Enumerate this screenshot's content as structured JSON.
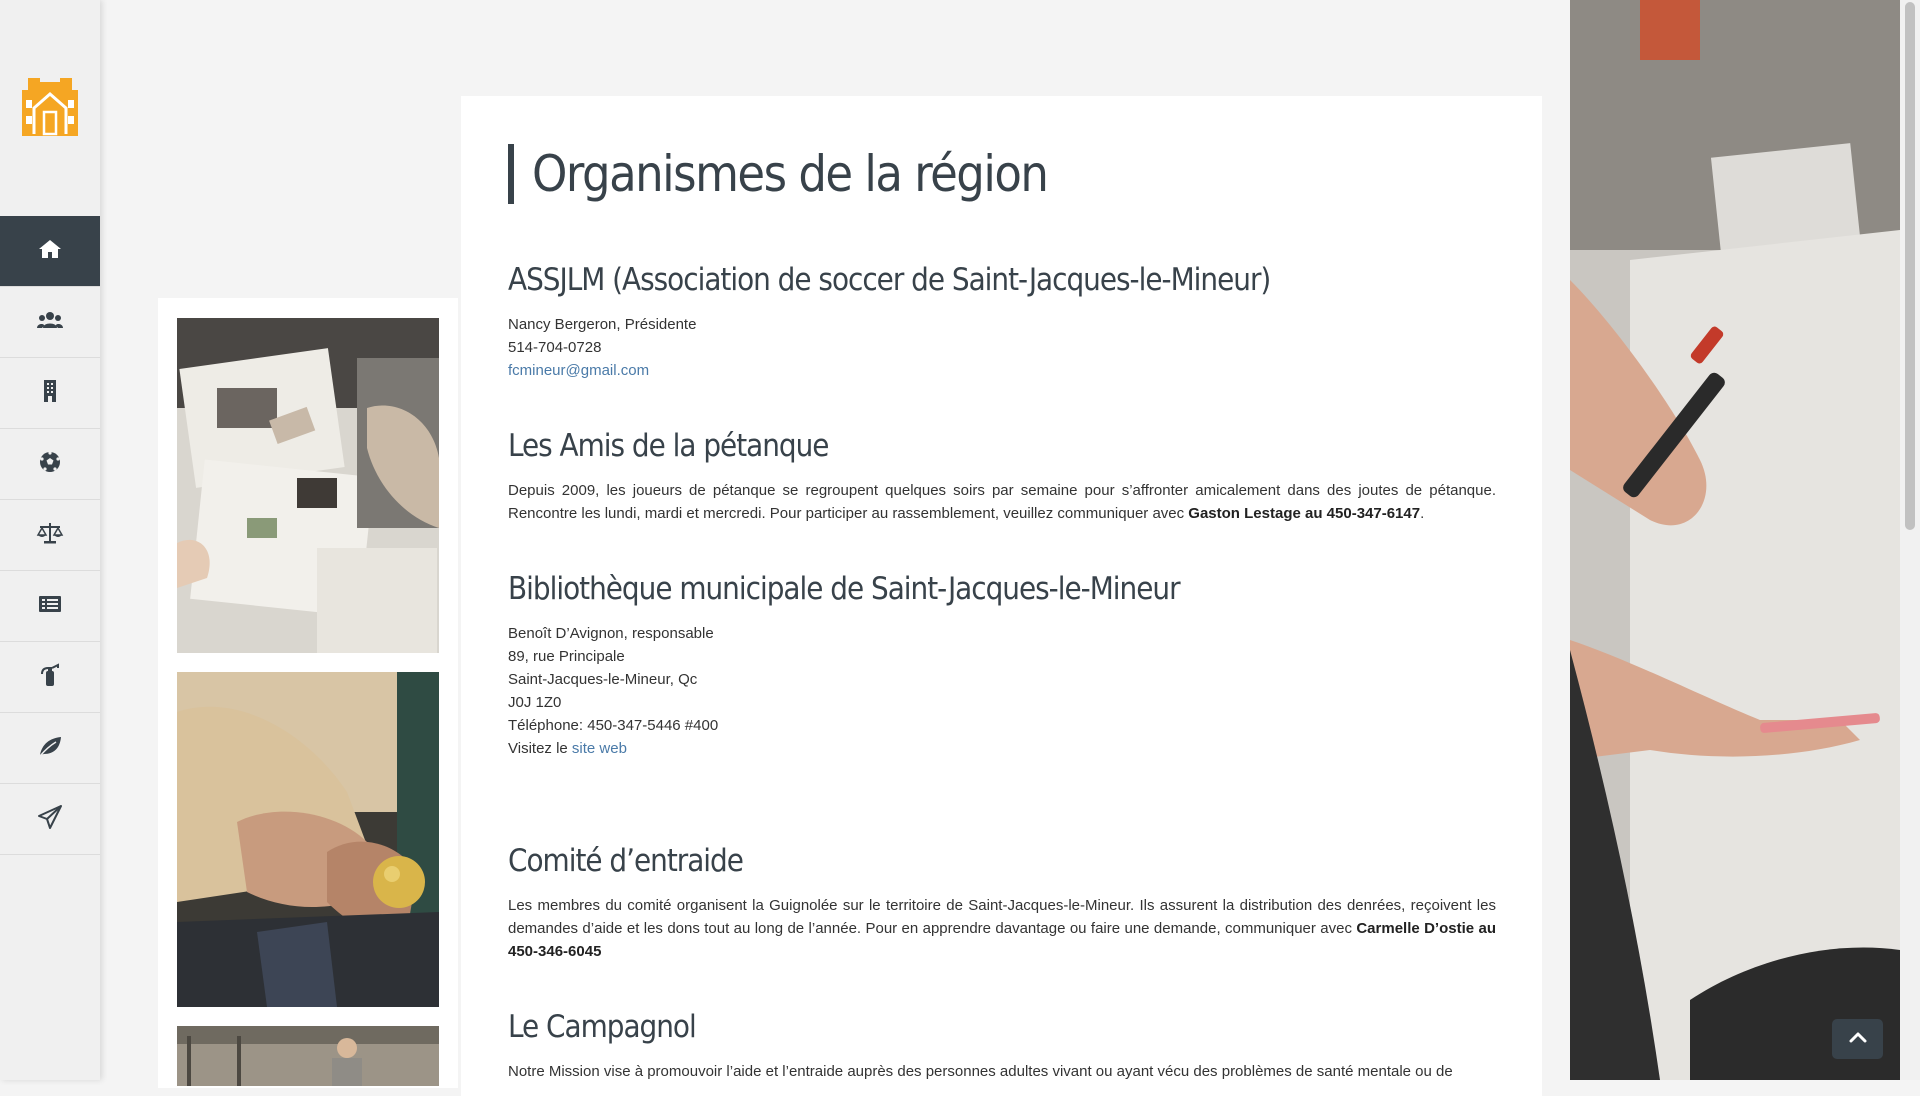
{
  "colors": {
    "accent": "#38424a",
    "link": "#4a7aa8",
    "logo": "#f5a623"
  },
  "sidebar": {
    "logo_icon": "house-logo-icon",
    "items": [
      {
        "icon": "home-icon",
        "active": true
      },
      {
        "icon": "users-icon",
        "active": false
      },
      {
        "icon": "building-icon",
        "active": false
      },
      {
        "icon": "soccer-ball-icon",
        "active": false
      },
      {
        "icon": "scales-icon",
        "active": false
      },
      {
        "icon": "list-icon",
        "active": false
      },
      {
        "icon": "fire-extinguisher-icon",
        "active": false
      },
      {
        "icon": "leaf-icon",
        "active": false
      },
      {
        "icon": "paper-plane-icon",
        "active": false
      }
    ]
  },
  "page": {
    "title": "Organismes de la région"
  },
  "sections": {
    "assjlm": {
      "title": "ASSJLM (Association de soccer de Saint-Jacques-le-Mineur)",
      "contact": "Nancy Bergeron, Présidente",
      "phone": "514-704-0728",
      "email": "fcmineur@gmail.com"
    },
    "petanque": {
      "title": "Les Amis de la pétanque",
      "text": "Depuis 2009, les joueurs de pétanque se regroupent quelques soirs par semaine pour s’affronter amicalement dans des joutes de pétanque. Rencontre les lundi, mardi et mercredi. Pour participer au rassemblement, veuillez communiquer avec ",
      "contact_bold": "Gaston Lestage au 450-347-6147",
      "end": "."
    },
    "bibliotheque": {
      "title": "Bibliothèque municipale de Saint-Jacques-le-Mineur",
      "contact": "Benoît D’Avignon, responsable",
      "address1": "89, rue Principale",
      "address2": "Saint-Jacques-le-Mineur, Qc",
      "postal": "J0J 1Z0",
      "phone": "Téléphone: 450-347-5446 #400",
      "visit_prefix": "Visitez le ",
      "visit_link": "site web"
    },
    "entraide": {
      "title": "Comité d’entraide",
      "text": "Les membres du comité organisent la Guignolée sur le territoire de Saint-Jacques-le-Mineur. Ils assurent la distribution des denrées, reçoivent les demandes d’aide et les dons tout au long de l’année. Pour en apprendre davantage ou faire une demande, communiquer avec ",
      "contact_bold": "Carmelle D’ostie au 450-346-6045"
    },
    "campagnol": {
      "title": "Le Campagnol",
      "text": "Notre Mission vise à promouvoir l’aide et l’entraide auprès des personnes adultes vivant ou ayant vécu des problèmes de santé mentale ou de"
    }
  },
  "back_to_top_icon": "chevron-up-icon"
}
